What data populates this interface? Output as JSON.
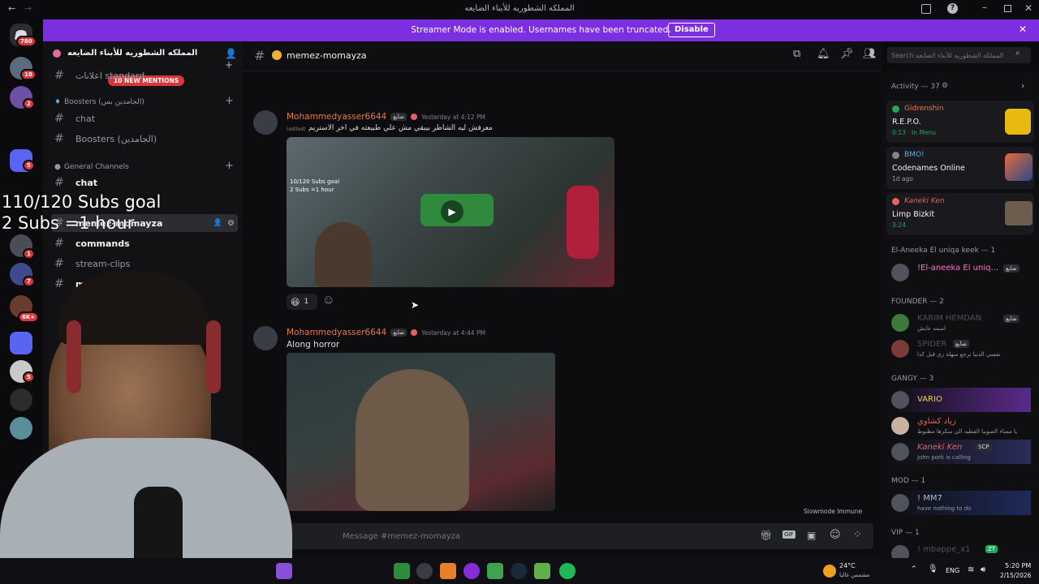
{
  "window": {
    "title": "المملكه الشطوريه للأبناء الضايعه"
  },
  "streamer_bar": {
    "message": "Streamer Mode is enabled. Usernames have been truncated.",
    "button": "Disable"
  },
  "rail": {
    "top_badge": "780",
    "badges": [
      "10",
      "2",
      "5",
      "1",
      "7",
      "6K+",
      "5"
    ]
  },
  "server": {
    "name": "المملكه الشطوريه للأبناء الضايعه",
    "mentions": "10 NEW MENTIONS"
  },
  "channels": {
    "announcements": "اعلانات standard",
    "boosters_cat": "Boosters (الجامدين بس)",
    "chat_boost": "chat",
    "boosters_ch": "Boosters (الجامدين)",
    "general_cat": "General Channels",
    "chat": "chat",
    "selected": "memez-momayza",
    "commands": "commands",
    "stream_clips": "stream-clips",
    "minigames": "minigames"
  },
  "header": {
    "channel": "memez-momayza",
    "search_placeholder": "Search المملكه الشطوريه للأبناء الضايعه"
  },
  "messages": [
    {
      "author": "Mohammedyasser6644",
      "tag": "ضايع",
      "time": "Yesterday at 4:12 PM",
      "edited": "(edited)",
      "text": "معرفش ليه الشاطر بيبقي مش علي طبيعته في اخر الاستريم",
      "reaction_count": "1",
      "embed_text": "10/120 Subs goal\n2 Subs =1 hour"
    },
    {
      "author": "Mohammedyasser6644",
      "tag": "ضايع",
      "time": "Yesterday at 4:44 PM",
      "text": "Along horror"
    }
  ],
  "composer": {
    "placeholder": "Message #memez-momayza",
    "slowmode": "Slowmode Immune"
  },
  "members": {
    "activity": "Activity — 37",
    "cards": [
      {
        "name": "Gidrenshin",
        "game": "R.E.P.O.",
        "detail": "0:13 · In Menu"
      },
      {
        "name": "BMO!",
        "game": "Codenames Online",
        "detail": "1d ago"
      },
      {
        "name": "Kaneki Ken",
        "game": "Limp Bizkit",
        "detail": "3:24"
      }
    ],
    "groups": [
      {
        "title": "El-Aneeka El uniqa keek — 1",
        "people": [
          {
            "name": "!El-aneeka El uniq...",
            "status": "",
            "tag": "ضايع"
          }
        ]
      },
      {
        "title": "FOUNDER — 2",
        "people": [
          {
            "name": "KARIM HEMDAN",
            "status": "اسمه عابش",
            "tag": "ضايع"
          },
          {
            "name": "SPIDER",
            "status": "نفسي الدنيا ترجع سهلة زي قبل كدا",
            "tag": "ضايع"
          }
        ]
      },
      {
        "title": "GANGY — 3",
        "people": [
          {
            "name": "VARIO",
            "status": "",
            "tag": ""
          },
          {
            "name": "زياد كشاوي",
            "status": "يا مساء الصوبيا القطيه الي سكرها مظبوط",
            "tag": ""
          },
          {
            "name": "Kaneki Ken",
            "status": "john pork is calling",
            "tag": "SCP"
          }
        ]
      },
      {
        "title": "MOD — 1",
        "people": [
          {
            "name": "! MM7",
            "status": "have nothing to do",
            "tag": ""
          }
        ]
      },
      {
        "title": "VIP — 1",
        "people": [
          {
            "name": "! mbappe_x1",
            "status": "",
            "tag": "ZT"
          }
        ]
      }
    ]
  },
  "overlay": {
    "goal_line1": "110/120 Subs goal",
    "goal_line2": "2 Subs =1 hour"
  },
  "taskbar": {
    "temp": "24°C",
    "weather": "مشمس غالبا",
    "lang": "ENG",
    "time": "5:20 PM",
    "date": "2/15/2026"
  }
}
